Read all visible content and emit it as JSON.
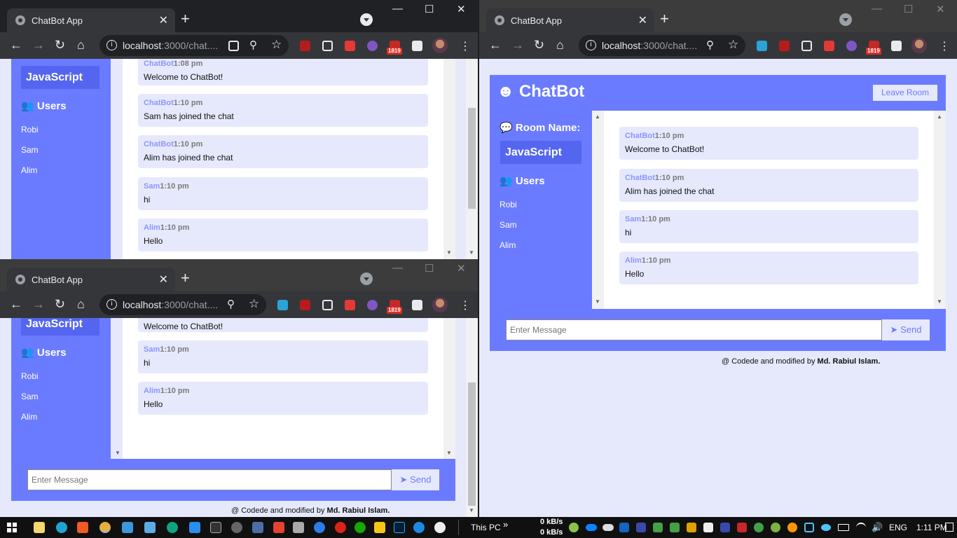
{
  "browser": {
    "tab_title": "ChatBot App",
    "url_host": "localhost",
    "url_path": ":3000/chat....",
    "badge": "1819",
    "minimize": "—",
    "maximize": "☐",
    "close": "✕",
    "new_tab": "+",
    "tab_close": "✕",
    "back": "←",
    "forward": "→",
    "reload": "↻",
    "home": "⌂",
    "zoom": "⚲",
    "star": "☆",
    "menu": "⋮",
    "info": "i"
  },
  "app": {
    "brand": "ChatBot",
    "brand_icon": "☻",
    "leave_button": "Leave Room",
    "room_label": "Room Name:",
    "room_name": "JavaScript",
    "users_label": "Users",
    "users": [
      "Robi",
      "Sam",
      "Alim"
    ],
    "input_placeholder": "Enter Message",
    "send_label": "Send",
    "send_icon": "➤",
    "footer_prefix": "@ Codede and modified by ",
    "footer_author": "Md. Rabiul Islam."
  },
  "window_top_left": {
    "messages": [
      {
        "user": "ChatBot",
        "time": "1:08 pm",
        "text": "Welcome to ChatBot!"
      },
      {
        "user": "ChatBot",
        "time": "1:10 pm",
        "text": "Sam has joined the chat"
      },
      {
        "user": "ChatBot",
        "time": "1:10 pm",
        "text": "Alim has joined the chat"
      },
      {
        "user": "Sam",
        "time": "1:10 pm",
        "text": "hi"
      },
      {
        "user": "Alim",
        "time": "1:10 pm",
        "text": "Hello"
      }
    ]
  },
  "window_bottom_left": {
    "messages": [
      {
        "user": "",
        "time": "",
        "text": "Welcome to ChatBot!"
      },
      {
        "user": "Sam",
        "time": "1:10 pm",
        "text": "hi"
      },
      {
        "user": "Alim",
        "time": "1:10 pm",
        "text": "Hello"
      }
    ]
  },
  "window_right": {
    "messages": [
      {
        "user": "ChatBot",
        "time": "1:10 pm",
        "text": "Welcome to ChatBot!"
      },
      {
        "user": "ChatBot",
        "time": "1:10 pm",
        "text": "Alim has joined the chat"
      },
      {
        "user": "Sam",
        "time": "1:10 pm",
        "text": "hi"
      },
      {
        "user": "Alim",
        "time": "1:10 pm",
        "text": "Hello"
      }
    ]
  },
  "taskbar": {
    "this_pc": "This PC",
    "chevron": "»",
    "net_up": "0 kB/s",
    "net_down": "0 kB/s",
    "lang": "ENG",
    "time": "1:11 PM"
  }
}
